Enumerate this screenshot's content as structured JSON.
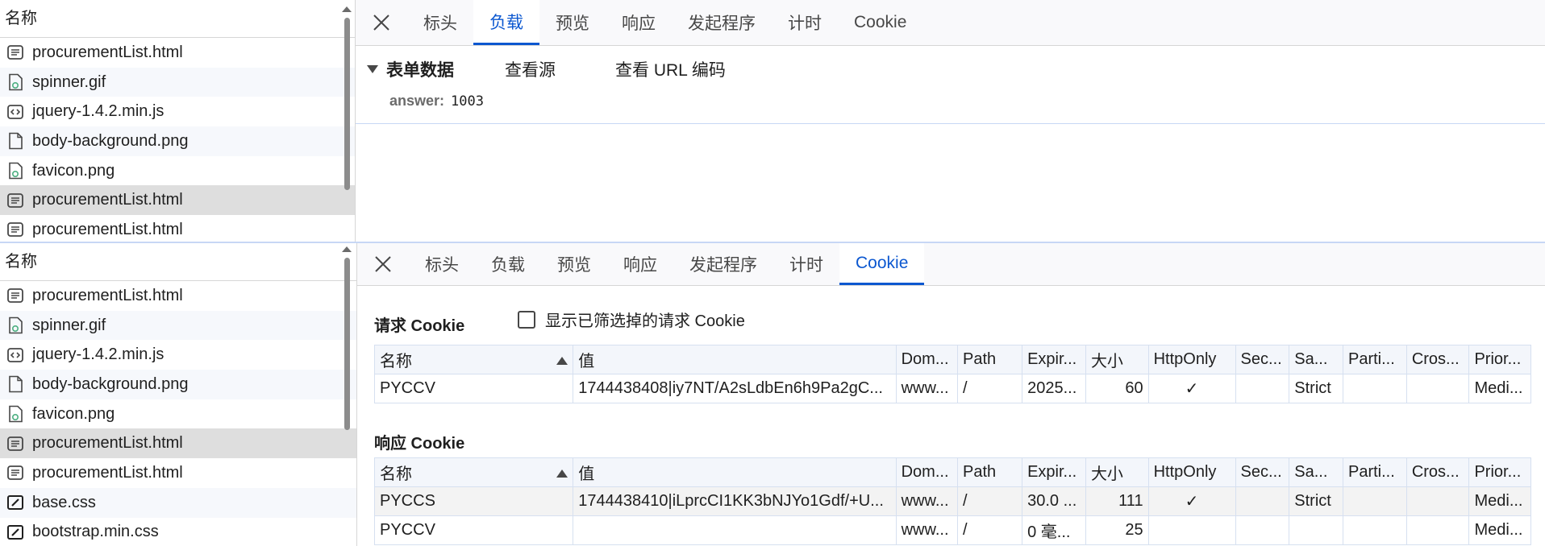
{
  "request_list": {
    "header": "名称",
    "top_items": [
      {
        "name": "procurementList.html",
        "icon": "document-icon"
      },
      {
        "name": "spinner.gif",
        "icon": "image-file-icon"
      },
      {
        "name": "jquery-1.4.2.min.js",
        "icon": "script-icon"
      },
      {
        "name": "body-background.png",
        "icon": "file-icon"
      },
      {
        "name": "favicon.png",
        "icon": "image-file-icon"
      },
      {
        "name": "procurementList.html",
        "icon": "document-icon",
        "selected": true
      },
      {
        "name": "procurementList.html",
        "icon": "document-icon"
      }
    ],
    "bottom_items": [
      {
        "name": "procurementList.html",
        "icon": "document-icon"
      },
      {
        "name": "spinner.gif",
        "icon": "image-file-icon"
      },
      {
        "name": "jquery-1.4.2.min.js",
        "icon": "script-icon"
      },
      {
        "name": "body-background.png",
        "icon": "file-icon"
      },
      {
        "name": "favicon.png",
        "icon": "image-file-icon"
      },
      {
        "name": "procurementList.html",
        "icon": "document-icon",
        "selected": true
      },
      {
        "name": "procurementList.html",
        "icon": "document-icon"
      },
      {
        "name": "base.css",
        "icon": "stylesheet-icon"
      },
      {
        "name": "bootstrap.min.css",
        "icon": "stylesheet-icon"
      }
    ]
  },
  "tabs": {
    "headers": "标头",
    "payload": "负载",
    "preview": "预览",
    "response": "响应",
    "initiator": "发起程序",
    "timing": "计时",
    "cookies": "Cookie"
  },
  "payload": {
    "section_title": "表单数据",
    "view_source": "查看源",
    "view_url_encoded": "查看 URL 编码",
    "field_key": "answer:",
    "field_value": "1003"
  },
  "cookies": {
    "request_title": "请求 Cookie",
    "show_filtered_label": "显示已筛选掉的请求 Cookie",
    "response_title": "响应 Cookie",
    "columns": [
      "名称",
      "值",
      "Dom...",
      "Path",
      "Expir...",
      "大小",
      "HttpOnly",
      "Sec...",
      "Sa...",
      "Parti...",
      "Cros...",
      "Prior..."
    ],
    "request_rows": [
      [
        "PYCCV",
        "1744438408|iy7NT/A2sLdbEn6h9Pa2gC...",
        "www...",
        "/",
        "2025...",
        "60",
        "✓",
        "",
        "Strict",
        "",
        "",
        "Medi..."
      ]
    ],
    "response_rows": [
      [
        "PYCCS",
        "1744438410|iLprcCI1KK3bNJYo1Gdf/+U...",
        "www...",
        "/",
        "30.0 ...",
        "111",
        "✓",
        "",
        "Strict",
        "",
        "",
        "Medi..."
      ],
      [
        "PYCCV",
        "",
        "www...",
        "/",
        "0 毫...",
        "25",
        "",
        "",
        "",
        "",
        "",
        "Medi..."
      ]
    ]
  },
  "colors": {
    "accent": "#0b57d0",
    "selected_row": "#dedede",
    "grid_border": "#d6e0f0"
  }
}
